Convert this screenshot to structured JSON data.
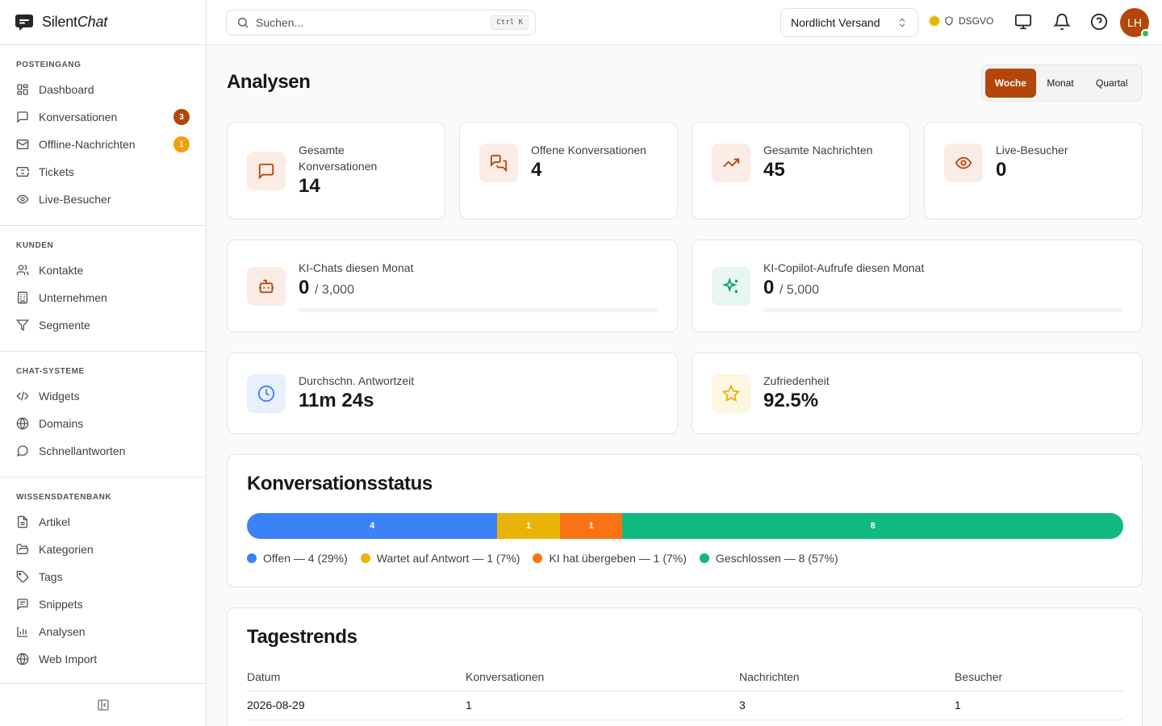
{
  "brand": {
    "name_part1": "Silent",
    "name_part2": "Chat"
  },
  "sidebar": {
    "sections": [
      {
        "title": "POSTEINGANG",
        "items": [
          {
            "label": "Dashboard",
            "icon": "layout-grid-icon"
          },
          {
            "label": "Konversationen",
            "icon": "message-square-icon",
            "badge": "3",
            "badge_color": "#b3470b"
          },
          {
            "label": "Offline-Nachrichten",
            "icon": "mail-icon",
            "badge": "1",
            "badge_color": "#f59e0b"
          },
          {
            "label": "Tickets",
            "icon": "ticket-icon"
          },
          {
            "label": "Live-Besucher",
            "icon": "eye-icon"
          }
        ]
      },
      {
        "title": "KUNDEN",
        "items": [
          {
            "label": "Kontakte",
            "icon": "users-icon"
          },
          {
            "label": "Unternehmen",
            "icon": "building-icon"
          },
          {
            "label": "Segmente",
            "icon": "filter-icon"
          }
        ]
      },
      {
        "title": "CHAT-SYSTEME",
        "items": [
          {
            "label": "Widgets",
            "icon": "code-icon"
          },
          {
            "label": "Domains",
            "icon": "globe-icon"
          },
          {
            "label": "Schnellantworten",
            "icon": "message-circle-icon"
          }
        ]
      },
      {
        "title": "WISSENSDATENBANK",
        "items": [
          {
            "label": "Artikel",
            "icon": "file-text-icon"
          },
          {
            "label": "Kategorien",
            "icon": "folder-open-icon"
          },
          {
            "label": "Tags",
            "icon": "tag-icon"
          },
          {
            "label": "Snippets",
            "icon": "message-square-text-icon"
          },
          {
            "label": "Analysen",
            "icon": "bar-chart-icon"
          },
          {
            "label": "Web Import",
            "icon": "globe-icon"
          }
        ]
      }
    ]
  },
  "topbar": {
    "search_placeholder": "Suchen...",
    "search_shortcut": "Ctrl K",
    "workspace": "Nordlicht Versand",
    "compliance_label": "DSGVO",
    "compliance_status_color": "#eab308",
    "avatar_initials": "LH",
    "avatar_color": "#b3470b"
  },
  "page": {
    "title": "Analysen",
    "period_options": [
      "Woche",
      "Monat",
      "Quartal"
    ],
    "period_selected": "Woche"
  },
  "stats": {
    "total_conversations": {
      "label": "Gesamte Konversationen",
      "value": "14"
    },
    "open_conversations": {
      "label": "Offene Konversationen",
      "value": "4"
    },
    "total_messages": {
      "label": "Gesamte Nachrichten",
      "value": "45"
    },
    "live_visitors": {
      "label": "Live-Besucher",
      "value": "0"
    },
    "ai_chats": {
      "label": "KI-Chats diesen Monat",
      "value": "0",
      "limit": "/ 3,000",
      "progress": 0
    },
    "ai_copilot": {
      "label": "KI-Copilot-Aufrufe diesen Monat",
      "value": "0",
      "limit": "/ 5,000",
      "progress": 0
    },
    "avg_response": {
      "label": "Durchschn. Antwortzeit",
      "value": "11m 24s"
    },
    "satisfaction": {
      "label": "Zufriedenheit",
      "value": "92.5%"
    }
  },
  "status": {
    "title": "Konversationsstatus",
    "segments": [
      {
        "label": "4",
        "value": 4,
        "color": "#3b82f6",
        "legend": "Offen — 4 (29%)"
      },
      {
        "label": "1",
        "value": 1,
        "color": "#eab308",
        "legend": "Wartet auf Antwort — 1 (7%)"
      },
      {
        "label": "1",
        "value": 1,
        "color": "#f97316",
        "legend": "KI hat übergeben — 1 (7%)"
      },
      {
        "label": "8",
        "value": 8,
        "color": "#10b981",
        "legend": "Geschlossen — 8 (57%)"
      }
    ]
  },
  "trends": {
    "title": "Tagestrends",
    "columns": [
      "Datum",
      "Konversationen",
      "Nachrichten",
      "Besucher"
    ],
    "rows": [
      [
        "2026-08-29",
        "1",
        "3",
        "1"
      ]
    ]
  }
}
